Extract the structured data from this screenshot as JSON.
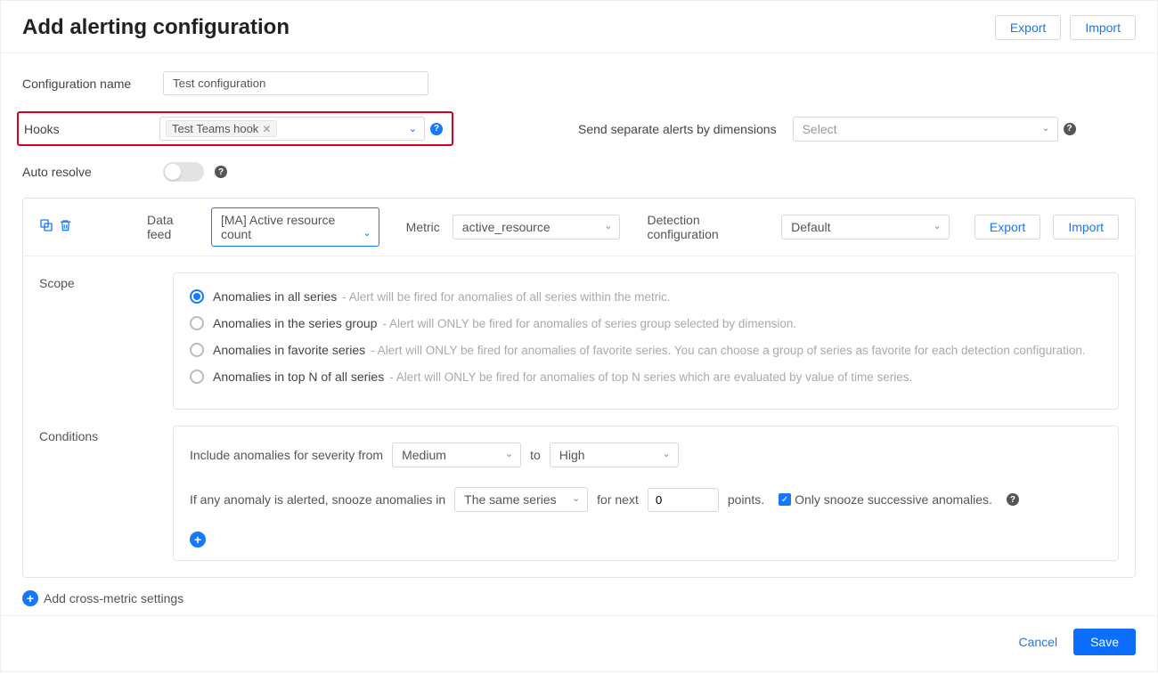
{
  "header": {
    "title": "Add alerting configuration",
    "export": "Export",
    "import": "Import"
  },
  "form": {
    "config_name_label": "Configuration name",
    "config_name_value": "Test configuration",
    "hooks_label": "Hooks",
    "hooks_tag": "Test Teams hook",
    "dim_label": "Send separate alerts by dimensions",
    "dim_select": "Select",
    "auto_resolve_label": "Auto resolve"
  },
  "panel": {
    "data_feed_label": "Data feed",
    "data_feed_value": "[MA] Active resource count",
    "metric_label": "Metric",
    "metric_value": "active_resource",
    "detect_label": "Detection configuration",
    "detect_value": "Default",
    "export": "Export",
    "import": "Import"
  },
  "scope": {
    "title": "Scope",
    "options": [
      {
        "label": "Anomalies in all series",
        "desc": "- Alert will be fired for anomalies of all series within the metric.",
        "checked": true
      },
      {
        "label": "Anomalies in the series group",
        "desc": "- Alert will ONLY be fired for anomalies of series group selected by dimension.",
        "checked": false
      },
      {
        "label": "Anomalies in favorite series",
        "desc": "- Alert will ONLY be fired for anomalies of favorite series. You can choose a group of series as favorite for each detection configuration.",
        "checked": false
      },
      {
        "label": "Anomalies in top N of all series",
        "desc": "- Alert will ONLY be fired for anomalies of top N series which are evaluated by value of time series.",
        "checked": false
      }
    ]
  },
  "conditions": {
    "title": "Conditions",
    "sev_prefix": "Include anomalies for severity from",
    "sev_from": "Medium",
    "sev_to_label": "to",
    "sev_to": "High",
    "snooze_prefix": "If any anomaly is alerted, snooze anomalies in",
    "snooze_scope": "The same series",
    "snooze_mid": "for next",
    "snooze_value": "0",
    "snooze_suffix": "points.",
    "snooze_check_label": "Only snooze successive anomalies."
  },
  "cross_metric": "Add cross-metric settings",
  "footer": {
    "cancel": "Cancel",
    "save": "Save"
  }
}
